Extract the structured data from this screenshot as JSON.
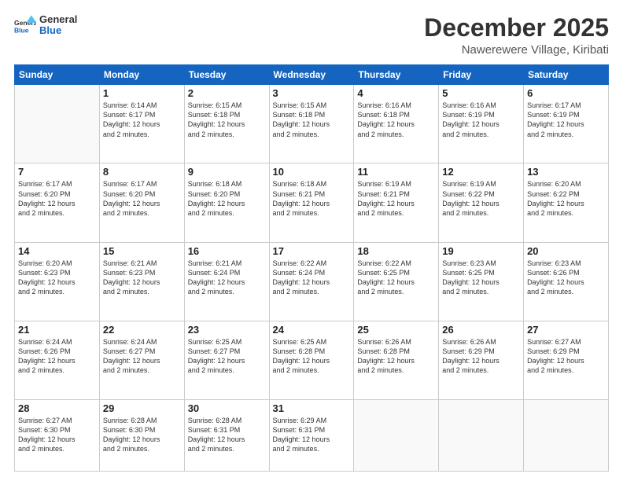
{
  "header": {
    "logo_general": "General",
    "logo_blue": "Blue",
    "month": "December 2025",
    "location": "Nawerewere Village, Kiribati"
  },
  "days_of_week": [
    "Sunday",
    "Monday",
    "Tuesday",
    "Wednesday",
    "Thursday",
    "Friday",
    "Saturday"
  ],
  "weeks": [
    [
      {
        "day": "",
        "info": ""
      },
      {
        "day": "1",
        "info": "Sunrise: 6:14 AM\nSunset: 6:17 PM\nDaylight: 12 hours\nand 2 minutes."
      },
      {
        "day": "2",
        "info": "Sunrise: 6:15 AM\nSunset: 6:18 PM\nDaylight: 12 hours\nand 2 minutes."
      },
      {
        "day": "3",
        "info": "Sunrise: 6:15 AM\nSunset: 6:18 PM\nDaylight: 12 hours\nand 2 minutes."
      },
      {
        "day": "4",
        "info": "Sunrise: 6:16 AM\nSunset: 6:18 PM\nDaylight: 12 hours\nand 2 minutes."
      },
      {
        "day": "5",
        "info": "Sunrise: 6:16 AM\nSunset: 6:19 PM\nDaylight: 12 hours\nand 2 minutes."
      },
      {
        "day": "6",
        "info": "Sunrise: 6:17 AM\nSunset: 6:19 PM\nDaylight: 12 hours\nand 2 minutes."
      }
    ],
    [
      {
        "day": "7",
        "info": "Sunrise: 6:17 AM\nSunset: 6:20 PM\nDaylight: 12 hours\nand 2 minutes."
      },
      {
        "day": "8",
        "info": "Sunrise: 6:17 AM\nSunset: 6:20 PM\nDaylight: 12 hours\nand 2 minutes."
      },
      {
        "day": "9",
        "info": "Sunrise: 6:18 AM\nSunset: 6:20 PM\nDaylight: 12 hours\nand 2 minutes."
      },
      {
        "day": "10",
        "info": "Sunrise: 6:18 AM\nSunset: 6:21 PM\nDaylight: 12 hours\nand 2 minutes."
      },
      {
        "day": "11",
        "info": "Sunrise: 6:19 AM\nSunset: 6:21 PM\nDaylight: 12 hours\nand 2 minutes."
      },
      {
        "day": "12",
        "info": "Sunrise: 6:19 AM\nSunset: 6:22 PM\nDaylight: 12 hours\nand 2 minutes."
      },
      {
        "day": "13",
        "info": "Sunrise: 6:20 AM\nSunset: 6:22 PM\nDaylight: 12 hours\nand 2 minutes."
      }
    ],
    [
      {
        "day": "14",
        "info": "Sunrise: 6:20 AM\nSunset: 6:23 PM\nDaylight: 12 hours\nand 2 minutes."
      },
      {
        "day": "15",
        "info": "Sunrise: 6:21 AM\nSunset: 6:23 PM\nDaylight: 12 hours\nand 2 minutes."
      },
      {
        "day": "16",
        "info": "Sunrise: 6:21 AM\nSunset: 6:24 PM\nDaylight: 12 hours\nand 2 minutes."
      },
      {
        "day": "17",
        "info": "Sunrise: 6:22 AM\nSunset: 6:24 PM\nDaylight: 12 hours\nand 2 minutes."
      },
      {
        "day": "18",
        "info": "Sunrise: 6:22 AM\nSunset: 6:25 PM\nDaylight: 12 hours\nand 2 minutes."
      },
      {
        "day": "19",
        "info": "Sunrise: 6:23 AM\nSunset: 6:25 PM\nDaylight: 12 hours\nand 2 minutes."
      },
      {
        "day": "20",
        "info": "Sunrise: 6:23 AM\nSunset: 6:26 PM\nDaylight: 12 hours\nand 2 minutes."
      }
    ],
    [
      {
        "day": "21",
        "info": "Sunrise: 6:24 AM\nSunset: 6:26 PM\nDaylight: 12 hours\nand 2 minutes."
      },
      {
        "day": "22",
        "info": "Sunrise: 6:24 AM\nSunset: 6:27 PM\nDaylight: 12 hours\nand 2 minutes."
      },
      {
        "day": "23",
        "info": "Sunrise: 6:25 AM\nSunset: 6:27 PM\nDaylight: 12 hours\nand 2 minutes."
      },
      {
        "day": "24",
        "info": "Sunrise: 6:25 AM\nSunset: 6:28 PM\nDaylight: 12 hours\nand 2 minutes."
      },
      {
        "day": "25",
        "info": "Sunrise: 6:26 AM\nSunset: 6:28 PM\nDaylight: 12 hours\nand 2 minutes."
      },
      {
        "day": "26",
        "info": "Sunrise: 6:26 AM\nSunset: 6:29 PM\nDaylight: 12 hours\nand 2 minutes."
      },
      {
        "day": "27",
        "info": "Sunrise: 6:27 AM\nSunset: 6:29 PM\nDaylight: 12 hours\nand 2 minutes."
      }
    ],
    [
      {
        "day": "28",
        "info": "Sunrise: 6:27 AM\nSunset: 6:30 PM\nDaylight: 12 hours\nand 2 minutes."
      },
      {
        "day": "29",
        "info": "Sunrise: 6:28 AM\nSunset: 6:30 PM\nDaylight: 12 hours\nand 2 minutes."
      },
      {
        "day": "30",
        "info": "Sunrise: 6:28 AM\nSunset: 6:31 PM\nDaylight: 12 hours\nand 2 minutes."
      },
      {
        "day": "31",
        "info": "Sunrise: 6:29 AM\nSunset: 6:31 PM\nDaylight: 12 hours\nand 2 minutes."
      },
      {
        "day": "",
        "info": ""
      },
      {
        "day": "",
        "info": ""
      },
      {
        "day": "",
        "info": ""
      }
    ]
  ]
}
